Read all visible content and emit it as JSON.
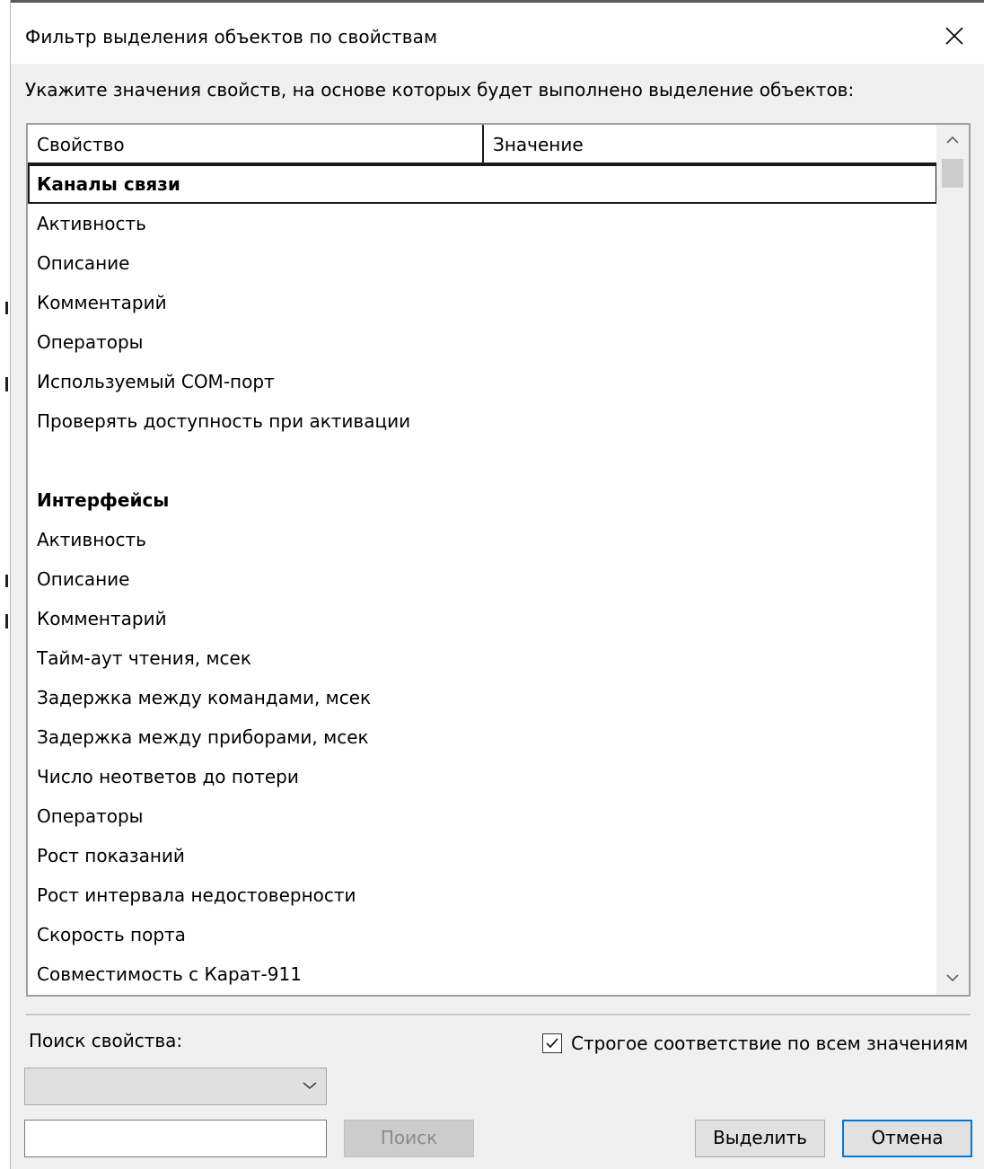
{
  "window": {
    "title": "Фильтр выделения объектов по свойствам",
    "instruction": "Укажите значения свойств, на основе которых будет выполнено выделение объектов:"
  },
  "grid": {
    "columns": [
      "Свойство",
      "Значение"
    ],
    "rows": [
      {
        "label": "Каналы связи",
        "type": "group",
        "selected": true
      },
      {
        "label": "Активность",
        "type": "item"
      },
      {
        "label": "Описание",
        "type": "item"
      },
      {
        "label": "Комментарий",
        "type": "item"
      },
      {
        "label": "Операторы",
        "type": "item"
      },
      {
        "label": "Используемый COM-порт",
        "type": "item"
      },
      {
        "label": "Проверять доступность при активации",
        "type": "item"
      },
      {
        "label": "",
        "type": "blank"
      },
      {
        "label": "Интерфейсы",
        "type": "group"
      },
      {
        "label": "Активность",
        "type": "item"
      },
      {
        "label": "Описание",
        "type": "item"
      },
      {
        "label": "Комментарий",
        "type": "item"
      },
      {
        "label": "Тайм-аут чтения, мсек",
        "type": "item"
      },
      {
        "label": "Задержка между командами, мсек",
        "type": "item"
      },
      {
        "label": "Задержка между приборами, мсек",
        "type": "item"
      },
      {
        "label": "Число неответов до потери",
        "type": "item"
      },
      {
        "label": "Операторы",
        "type": "item"
      },
      {
        "label": "Рост показаний",
        "type": "item"
      },
      {
        "label": "Рост интервала недостоверности",
        "type": "item"
      },
      {
        "label": "Скорость порта",
        "type": "item"
      },
      {
        "label": "Совместимость с Карат-911",
        "type": "item"
      }
    ]
  },
  "search": {
    "label": "Поиск свойства:",
    "combo_value": "",
    "input_value": "",
    "button": "Поиск"
  },
  "strict_match": {
    "label": "Строгое соответствие по всем значениям",
    "checked": true
  },
  "buttons": {
    "select": "Выделить",
    "cancel": "Отмена"
  },
  "icons": {
    "close": "close-icon",
    "scroll_up": "chevron-up-icon",
    "scroll_down": "chevron-down-icon",
    "combo": "chevron-down-icon",
    "check": "check-icon"
  }
}
